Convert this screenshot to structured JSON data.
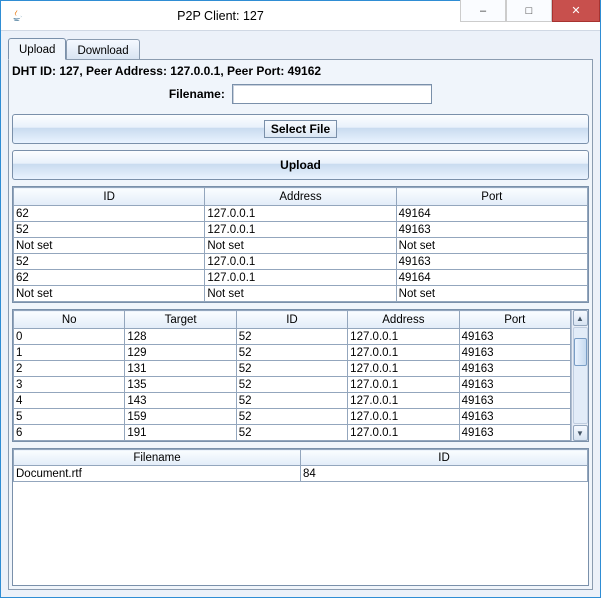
{
  "window": {
    "title": "P2P Client: 127",
    "controls": {
      "min": "–",
      "max": "□",
      "close": "✕"
    }
  },
  "tabs": {
    "upload_label": "Upload",
    "download_label": "Download",
    "active": "Upload"
  },
  "info_line": "DHT ID: 127, Peer Address: 127.0.0.1, Peer Port: 49162",
  "filename_label": "Filename:",
  "filename_value": "",
  "select_file_label": "Select File",
  "upload_button_label": "Upload",
  "table1": {
    "headers": [
      "ID",
      "Address",
      "Port"
    ],
    "rows": [
      [
        "62",
        "127.0.0.1",
        "49164"
      ],
      [
        "52",
        "127.0.0.1",
        "49163"
      ],
      [
        "Not set",
        "Not set",
        "Not set"
      ],
      [
        "52",
        "127.0.0.1",
        "49163"
      ],
      [
        "62",
        "127.0.0.1",
        "49164"
      ],
      [
        "Not set",
        "Not set",
        "Not set"
      ]
    ]
  },
  "table2": {
    "headers": [
      "No",
      "Target",
      "ID",
      "Address",
      "Port"
    ],
    "rows": [
      [
        "0",
        "128",
        "52",
        "127.0.0.1",
        "49163"
      ],
      [
        "1",
        "129",
        "52",
        "127.0.0.1",
        "49163"
      ],
      [
        "2",
        "131",
        "52",
        "127.0.0.1",
        "49163"
      ],
      [
        "3",
        "135",
        "52",
        "127.0.0.1",
        "49163"
      ],
      [
        "4",
        "143",
        "52",
        "127.0.0.1",
        "49163"
      ],
      [
        "5",
        "159",
        "52",
        "127.0.0.1",
        "49163"
      ],
      [
        "6",
        "191",
        "52",
        "127.0.0.1",
        "49163"
      ]
    ]
  },
  "table3": {
    "headers": [
      "Filename",
      "ID"
    ],
    "rows": [
      [
        "Document.rtf",
        "84"
      ]
    ]
  },
  "icons": {
    "java": "java-icon",
    "scroll_up": "▲",
    "scroll_down": "▼"
  }
}
